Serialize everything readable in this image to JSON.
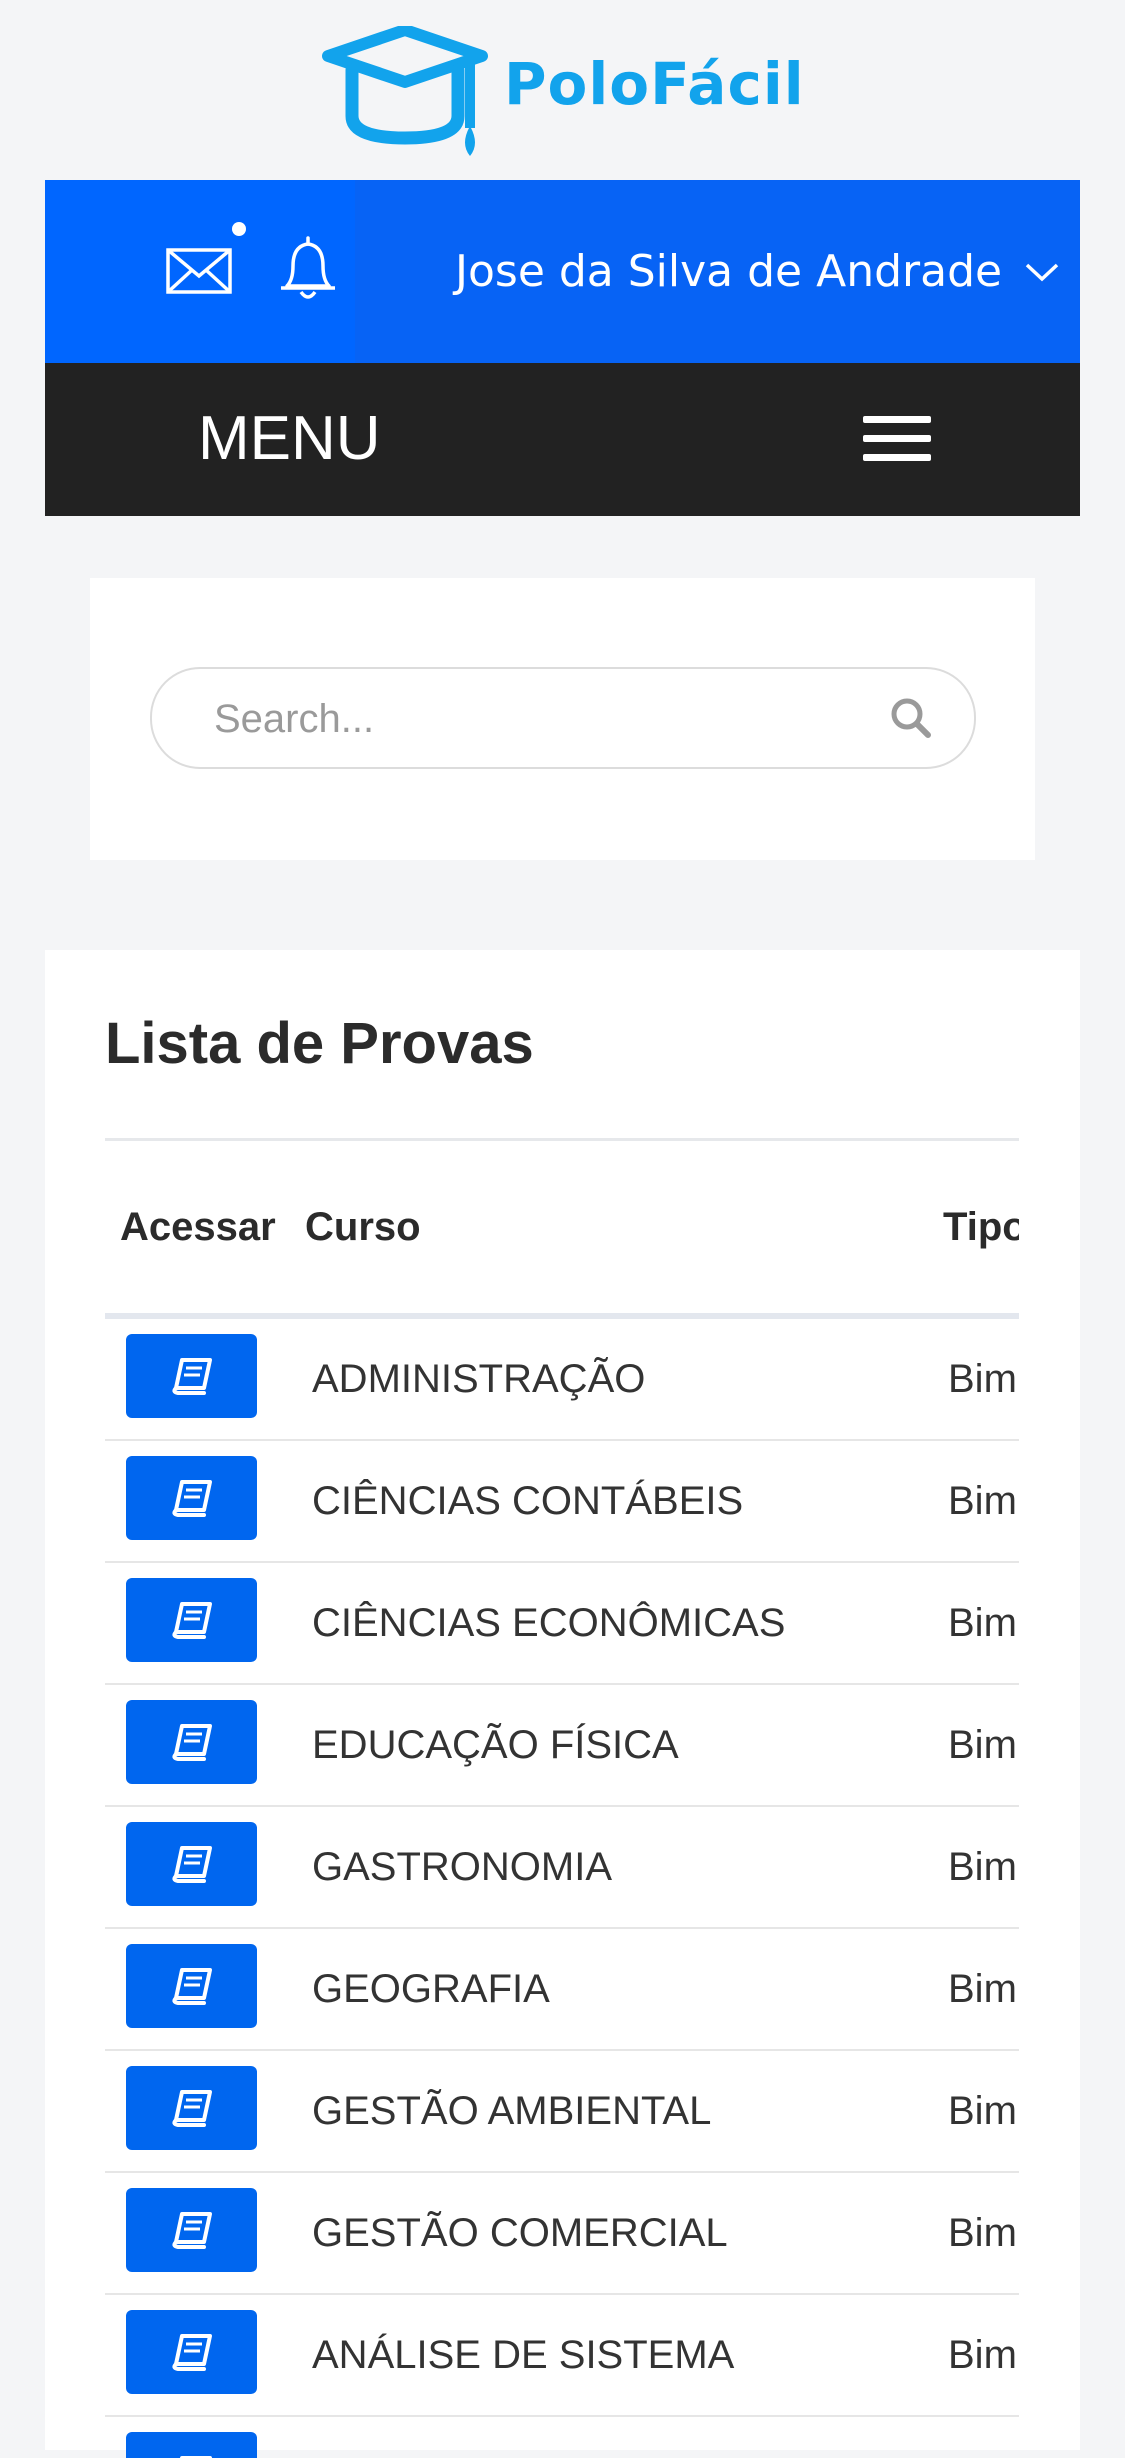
{
  "brand": {
    "name": "PoloFácil"
  },
  "header": {
    "user_name": "Jose da Silva de Andrade",
    "menu_label": "MENU"
  },
  "search": {
    "placeholder": "Search...",
    "value": ""
  },
  "list": {
    "title": "Lista de Provas",
    "columns": [
      "Acessar",
      "Curso",
      "Tipo"
    ],
    "rows": [
      {
        "curso": "ADMINISTRAÇÃO",
        "tipo": "Bim"
      },
      {
        "curso": "CIÊNCIAS CONTÁBEIS",
        "tipo": "Bim"
      },
      {
        "curso": "CIÊNCIAS ECONÔMICAS",
        "tipo": "Bim"
      },
      {
        "curso": "EDUCAÇÃO FÍSICA",
        "tipo": "Bim"
      },
      {
        "curso": "GASTRONOMIA",
        "tipo": "Bim"
      },
      {
        "curso": "GEOGRAFIA",
        "tipo": "Bim"
      },
      {
        "curso": "GESTÃO AMBIENTAL",
        "tipo": "Bim"
      },
      {
        "curso": "GESTÃO COMERCIAL",
        "tipo": "Bim"
      },
      {
        "curso": "ANÁLISE DE SISTEMA",
        "tipo": "Bim"
      },
      {
        "curso": "",
        "tipo": ""
      }
    ]
  },
  "icons": {
    "logo": "graduation-cap-icon",
    "mail": "envelope-icon",
    "notifications": "bell-icon",
    "user_menu": "chevron-down-icon",
    "menu": "hamburger-icon",
    "search": "search-icon",
    "access": "book-icon"
  },
  "colors": {
    "brand": "#12a3ec",
    "primary": "#0066ff",
    "menu_bar": "#222222",
    "button": "#0066ef"
  }
}
